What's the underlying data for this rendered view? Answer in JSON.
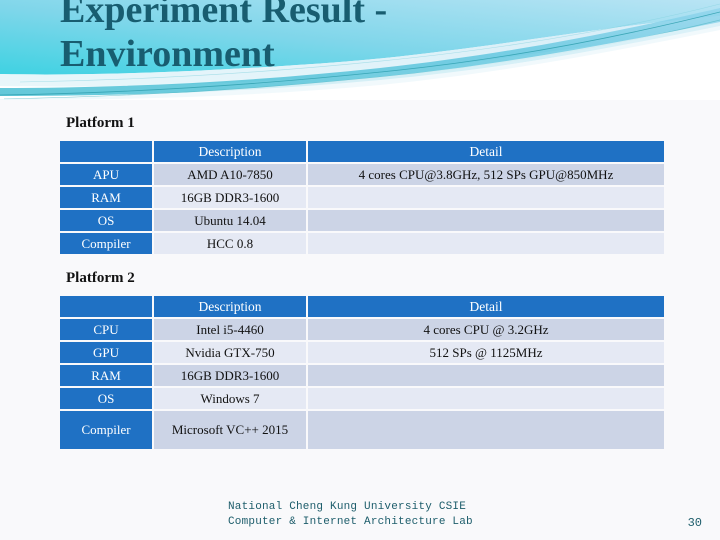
{
  "slide": {
    "title": "Experiment Result -\nEnvironment",
    "background_color": "#f9f9fb",
    "title_color": "#185d70",
    "accent_color": "#1f71c4",
    "wave_colors": {
      "cyan": "#3ed0e0",
      "light_blue": "#9fd9ef",
      "teal_line": "#2e9fae",
      "pale": "#dff2f8"
    }
  },
  "platform1": {
    "caption": "Platform 1",
    "columns": [
      "",
      "Description",
      "Detail"
    ],
    "rows": [
      {
        "label": "APU",
        "description": "AMD A10-7850",
        "detail": "4 cores CPU@3.8GHz, 512 SPs GPU@850MHz"
      },
      {
        "label": "RAM",
        "description": "16GB DDR3-1600",
        "detail": ""
      },
      {
        "label": "OS",
        "description": "Ubuntu 14.04",
        "detail": ""
      },
      {
        "label": "Compiler",
        "description": "HCC 0.8",
        "detail": ""
      }
    ]
  },
  "platform2": {
    "caption": "Platform 2",
    "columns": [
      "",
      "Description",
      "Detail"
    ],
    "rows": [
      {
        "label": "CPU",
        "description": "Intel i5-4460",
        "detail": "4 cores CPU @ 3.2GHz"
      },
      {
        "label": "GPU",
        "description": "Nvidia GTX-750",
        "detail": "512 SPs @ 1125MHz"
      },
      {
        "label": "RAM",
        "description": "16GB DDR3-1600",
        "detail": ""
      },
      {
        "label": "OS",
        "description": "Windows 7",
        "detail": ""
      },
      {
        "label": "Compiler",
        "description": "Microsoft VC++ 2015",
        "detail": ""
      }
    ]
  },
  "footer": {
    "line1": "National Cheng Kung University CSIE",
    "line2": "Computer & Internet Architecture Lab",
    "text": "National Cheng Kung University CSIE\nComputer & Internet Architecture Lab",
    "page_number": "30"
  }
}
